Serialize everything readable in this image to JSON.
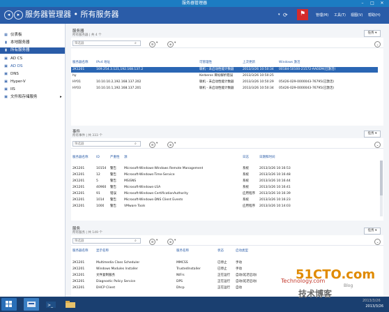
{
  "window": {
    "title": "服务器管理器"
  },
  "header": {
    "title": "服务器管理器 • 所有服务器",
    "menus": [
      "管理(M)",
      "工具(T)",
      "视图(V)",
      "帮助(H)"
    ]
  },
  "sidebar": {
    "items": [
      {
        "label": "仪表板",
        "icon": "▦",
        "active": false
      },
      {
        "label": "本地服务器",
        "icon": "▮",
        "active": false
      },
      {
        "label": "所有服务器",
        "icon": "▮",
        "active": true
      },
      {
        "label": "AD CS",
        "icon": "▣",
        "active": false
      },
      {
        "label": "AD DS",
        "icon": "▣",
        "active": false
      },
      {
        "label": "DNS",
        "icon": "▣",
        "active": false
      },
      {
        "label": "Hyper-V",
        "icon": "▣",
        "active": false
      },
      {
        "label": "IIS",
        "icon": "▣",
        "active": false
      },
      {
        "label": "文件和存储服务",
        "icon": "▣",
        "active": false,
        "chevron": "▸"
      }
    ]
  },
  "servers_panel": {
    "title": "服务器",
    "subtitle": "所有服务器 | 共 4 个",
    "tasks_label": "任务 ▾",
    "filter_placeholder": "筛选器",
    "columns": [
      "服务器名称",
      "IPv4 地址",
      "可管理性",
      "上次更新",
      "Windows 激活"
    ],
    "rows": [
      [
        "2K1201",
        "169.254.3.121,192.168.137.2",
        "联机 - 未启动性能计数器",
        "2013/3/26 10:50:34",
        "00184-50100-21572-AAOEM(已激活)"
      ],
      [
        "hy",
        "",
        "Kerberos 目标解析错误",
        "2013/3/26 10:50:25",
        ""
      ],
      [
        "HY01",
        "10.10.10.2,192.168.137.202",
        "联机 - 未启动性能计数器",
        "2013/3/26 10:50:29",
        "05426-029-0000043-76795(已激活)"
      ],
      [
        "HY03",
        "10.10.10.1,192.168.137.201",
        "联机 - 未启动性能计数器",
        "2013/3/26 10:50:34",
        "05426-029-0000043-76795(已激活)"
      ]
    ]
  },
  "events_panel": {
    "title": "事件",
    "subtitle": "所有事件 | 共 333 个",
    "tasks_label": "任务 ▾",
    "filter_placeholder": "筛选器",
    "columns": [
      "服务器名称",
      "ID",
      "严重性",
      "源",
      "日志",
      "日期和时间"
    ],
    "rows": [
      [
        "2K1201",
        "10154",
        "警告",
        "Microsoft-Windows-Windows Remote Management",
        "系统",
        "2013/3/26 10:16:53"
      ],
      [
        "2K1201",
        "12",
        "警告",
        "Microsoft-Windows-Time-Service",
        "系统",
        "2013/3/26 10:16:48"
      ],
      [
        "2K1201",
        "5",
        "警告",
        "MSiSNS",
        "系统",
        "2013/3/26 10:16:44"
      ],
      [
        "2K1201",
        "40960",
        "警告",
        "Microsoft-Windows-LSA",
        "系统",
        "2013/3/26 10:16:41"
      ],
      [
        "2K1201",
        "91",
        "错误",
        "Microsoft-Windows-CertificationAuthority",
        "应用程序",
        "2013/3/26 10:16:39"
      ],
      [
        "2K1201",
        "1014",
        "警告",
        "Microsoft-Windows-DNS Client Events",
        "系统",
        "2013/3/26 10:16:23"
      ],
      [
        "2K1201",
        "1000",
        "警告",
        "VMware Tools",
        "应用程序",
        "2013/3/26 10:14:03"
      ]
    ]
  },
  "services_panel": {
    "title": "服务",
    "subtitle": "所有服务 | 共 149 个",
    "tasks_label": "任务 ▾",
    "filter_placeholder": "筛选器",
    "columns": [
      "服务器名称",
      "显示名称",
      "服务名称",
      "状态",
      "启动类型"
    ],
    "rows": [
      [
        "2K1201",
        "Multimedia Class Scheduler",
        "MMCSS",
        "已停止",
        "手动"
      ],
      [
        "2K1201",
        "Windows Modules Installer",
        "TrustedInstaller",
        "已停止",
        "手动"
      ],
      [
        "2K1201",
        "文件复制服务",
        "NtFrs",
        "正在运行",
        "自动(延迟启动)"
      ],
      [
        "2K1201",
        "Diagnostic Policy Service",
        "DPS",
        "正在运行",
        "自动(延迟启动)"
      ],
      [
        "2K1201",
        "DHCP Client",
        "Dhcp",
        "正在运行",
        "自动"
      ]
    ]
  },
  "taskbar": {
    "date": "2013/3/26"
  },
  "watermark": {
    "logo": "51CTO.com",
    "site": "Technology.com",
    "cn": "技术博客",
    "blog": "Blog",
    "small": "2013/3/26"
  },
  "colors": {
    "header": "#2a5ca8",
    "titlebar": "#1c7cc2",
    "selection": "#2a66b4",
    "flag": "#d42b2b"
  }
}
